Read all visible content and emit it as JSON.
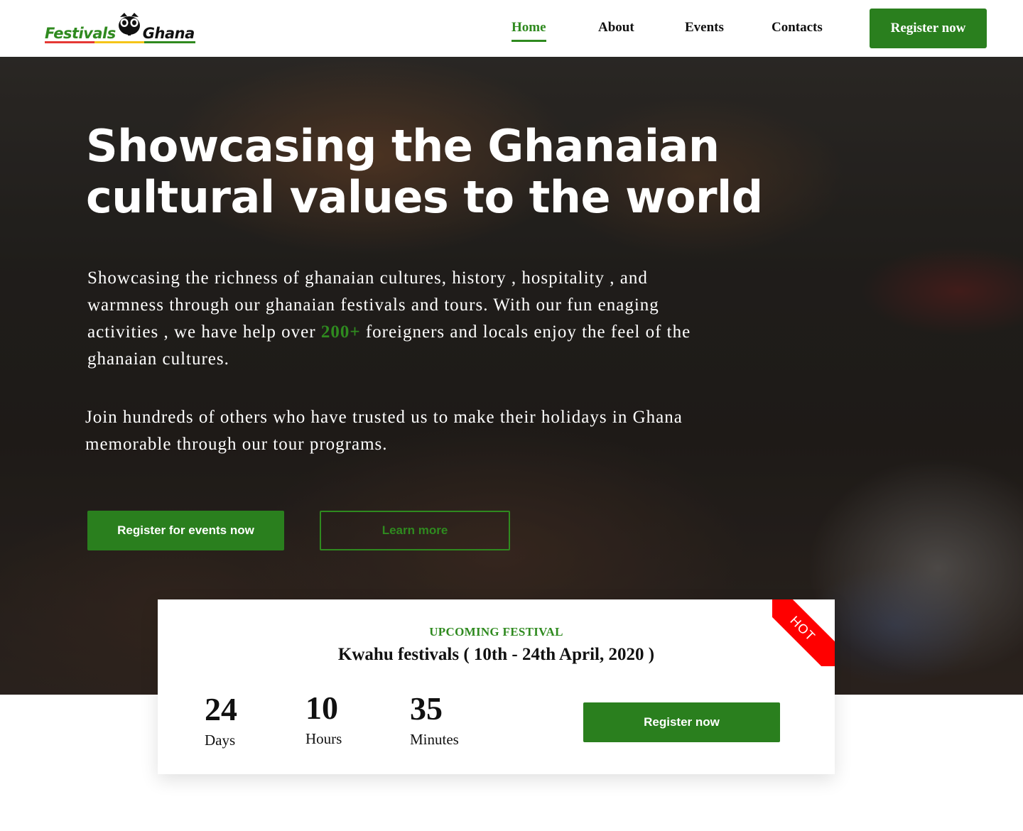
{
  "brand": {
    "word_left": "Festivals",
    "word_right": "Ghana",
    "colors": {
      "green": "#2f8a1f",
      "red": "#e53935",
      "yellow": "#f5c518"
    }
  },
  "nav": {
    "links": [
      {
        "label": "Home",
        "active": true
      },
      {
        "label": "About",
        "active": false
      },
      {
        "label": "Events",
        "active": false
      },
      {
        "label": "Contacts",
        "active": false
      }
    ],
    "cta_label": "Register now"
  },
  "hero": {
    "title": "Showcasing the Ghanaian cultural values to the world",
    "para1_before": "Showcasing the richness of ghanaian cultures,  history , hospitality , and warmness through our ghanaian festivals and tours. With our fun enaging activities , we have help over ",
    "para1_accent": "200+",
    "para1_after": "  foreigners and locals enjoy the feel of the ghanaian cultures.",
    "para2": "Join hundreds of others who have trusted us to make their holidays in Ghana memorable through our tour programs.",
    "primary_button": "Register for events now",
    "secondary_button": "Learn more",
    "accent_color": "#2a7f1e"
  },
  "upcoming": {
    "ribbon": "HOT",
    "label": "UPCOMING FESTIVAL",
    "title": "Kwahu festivals ( 10th - 24th April, 2020 )",
    "countdown": {
      "days": {
        "value": "24",
        "unit": "Days"
      },
      "hours": {
        "value": "10",
        "unit": "Hours"
      },
      "minutes": {
        "value": "35",
        "unit": "Minutes"
      }
    },
    "button": "Register now",
    "ribbon_color": "#ff0000"
  }
}
